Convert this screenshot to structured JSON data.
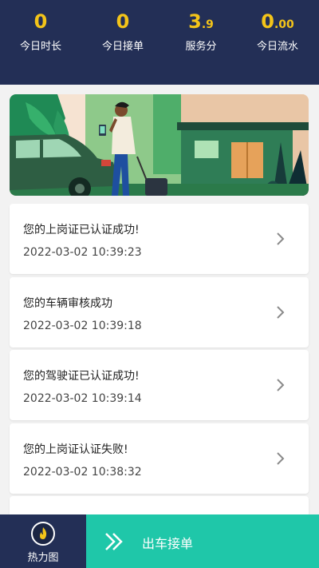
{
  "stats": [
    {
      "value": "0",
      "value_small": "",
      "label": "今日时长"
    },
    {
      "value": "0",
      "value_small": "",
      "label": "今日接单"
    },
    {
      "value": "3",
      "value_small": ".9",
      "label": "服务分"
    },
    {
      "value": "0",
      "value_small": ".00",
      "label": "今日流水"
    }
  ],
  "messages": [
    {
      "title": "您的上岗证已认证成功!",
      "time": "2022-03-02 10:39:23"
    },
    {
      "title": "您的车辆审核成功",
      "time": "2022-03-02 10:39:18"
    },
    {
      "title": "您的驾驶证已认证成功!",
      "time": "2022-03-02 10:39:14"
    },
    {
      "title": "您的上岗证认证失败!",
      "time": "2022-03-02 10:38:32"
    }
  ],
  "bottom": {
    "heatmap_label": "热力图",
    "start_label": "出车接单"
  },
  "colors": {
    "header_bg": "#232f56",
    "stat_value": "#f3c419",
    "accent": "#1fc7a9"
  }
}
